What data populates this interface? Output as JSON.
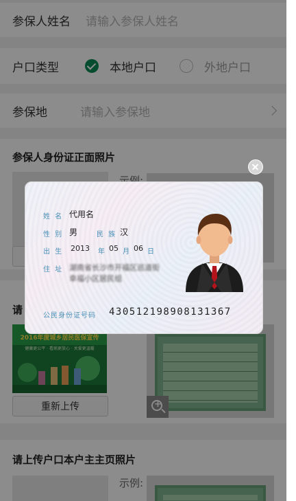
{
  "form": {
    "name_label": "参保人姓名",
    "name_placeholder": "请输入参保人姓名",
    "hukou_label": "户口类型",
    "hukou_options": [
      "本地户口",
      "外地户口"
    ],
    "hukou_selected": "本地户口",
    "location_label": "参保地",
    "location_placeholder": "请输入参保地"
  },
  "sections": {
    "id_front_title": "参保人身份证正面照片",
    "example_label": "示例:",
    "second_title_partial": "请",
    "reupload_label": "重新上传",
    "hukou_page_title": "请上传户口本户主主页照片",
    "example_label_3": "示例:"
  },
  "poster": {
    "headline": "2016年度城乡居民医保宣传",
    "subline": "健康更公平 · 看病更放心 · 关爱更温暖"
  },
  "modal": {
    "card": {
      "name_key": "姓 名",
      "name_value": "代用名",
      "gender_key": "性 别",
      "gender_value": "男",
      "ethnicity_key": "民 族",
      "ethnicity_value": "汉",
      "birth_key": "出 生",
      "birth_year": "2013",
      "year_unit": "年",
      "birth_month": "05",
      "month_unit": "月",
      "birth_day": "06",
      "day_unit": "日",
      "address_key": "住 址",
      "address_line1": "湖南省长沙市开福区巡道街",
      "address_line2": "幸福小区居民组",
      "id_key": "公民身份证号码",
      "id_value": "430512198908131367"
    }
  },
  "colors": {
    "accent": "#0b8a57",
    "overlay": "rgba(0,0,0,0.45)",
    "card_key": "#4b90b8"
  }
}
